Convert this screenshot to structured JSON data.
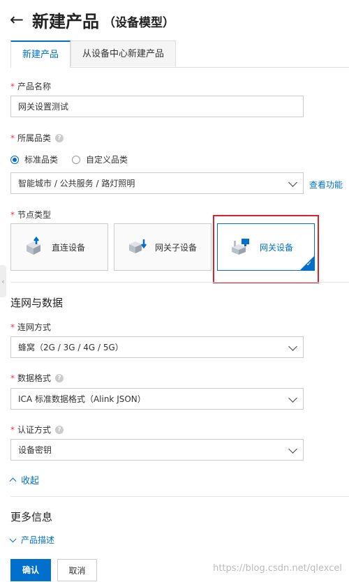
{
  "header": {
    "title": "新建产品",
    "subtitle": "（设备模型）"
  },
  "tabs": [
    {
      "label": "新建产品"
    },
    {
      "label": "从设备中心新建产品"
    }
  ],
  "form": {
    "product_name": {
      "label": "产品名称",
      "value": "网关设置测试"
    },
    "category": {
      "label": "所属品类",
      "options": [
        "标准品类",
        "自定义品类"
      ],
      "selected": "智能城市 / 公共服务 / 路灯照明",
      "link": "查看功能"
    },
    "node_type": {
      "label": "节点类型",
      "options": [
        "直连设备",
        "网关子设备",
        "网关设备"
      ]
    },
    "network_section": {
      "title": "连网与数据"
    },
    "network_method": {
      "label": "连网方式",
      "value": "蜂窝（2G / 3G / 4G / 5G）"
    },
    "data_format": {
      "label": "数据格式",
      "value": "ICA 标准数据格式（Alink JSON）"
    },
    "auth_method": {
      "label": "认证方式",
      "value": "设备密钥"
    },
    "collapse_label": "收起",
    "more_section": {
      "title": "更多信息"
    },
    "product_desc": "产品描述"
  },
  "footer": {
    "confirm": "确认",
    "cancel": "取消"
  },
  "watermark": "https://blog.csdn.net/qlexcel",
  "colors": {
    "accent": "#0070cc",
    "required": "#e34444",
    "highlight": "#d9232a"
  }
}
